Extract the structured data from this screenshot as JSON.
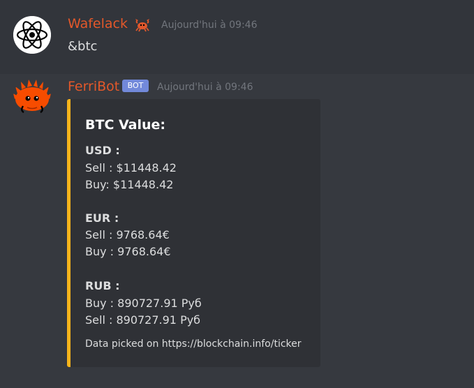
{
  "messages": [
    {
      "author": "Wafelack",
      "timestamp": "Aujourd'hui à 09:46",
      "content": "&btc",
      "avatar_icon": "atom-icon",
      "badge_icon": "crab-icon"
    },
    {
      "author": "FerriBot",
      "bot_tag": "BOT",
      "timestamp": "Aujourd'hui à 09:46",
      "avatar_icon": "ferris-crab-icon",
      "embed": {
        "accent_color": "#f8b41b",
        "title": "BTC Value:",
        "usd_label": "USD :",
        "usd_sell": "Sell : $11448.42",
        "usd_buy": "Buy: $11448.42",
        "eur_label": "EUR :",
        "eur_sell": "Sell : 9768.64€",
        "eur_buy": "Buy : 9768.64€",
        "rub_label": "RUB :",
        "rub_buy": "Buy : 890727.91 Руб",
        "rub_sell": "Sell : 890727.91 Руб",
        "footer": "Data picked on https://blockchain.info/ticker"
      }
    }
  ],
  "colors": {
    "background": "#36393f",
    "username": "#e3582a",
    "bot_tag": "#7289da",
    "text": "#dcddde",
    "timestamp": "#72767d"
  }
}
